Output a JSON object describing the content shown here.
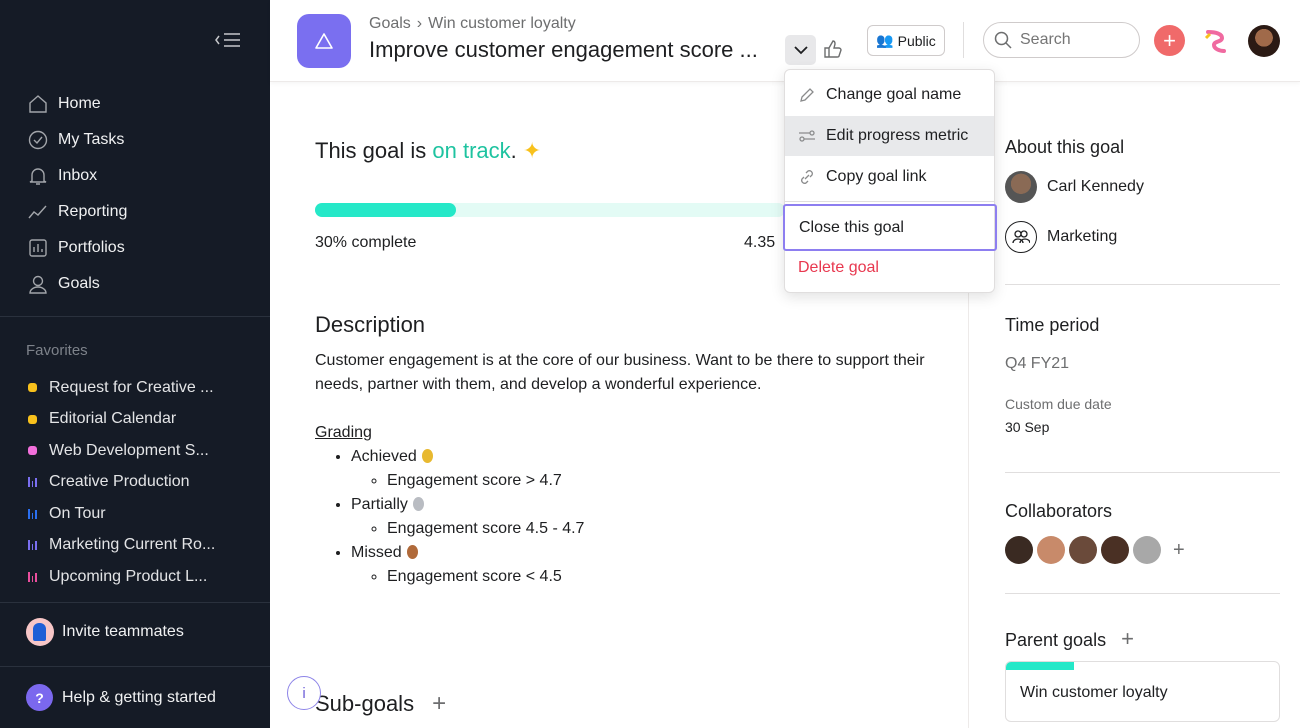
{
  "sidebar": {
    "collapse_icon": "collapse-sidebar-icon",
    "nav": [
      {
        "label": "Home",
        "icon": "home-icon"
      },
      {
        "label": "My Tasks",
        "icon": "check-circle-icon"
      },
      {
        "label": "Inbox",
        "icon": "bell-icon"
      },
      {
        "label": "Reporting",
        "icon": "line-chart-icon"
      },
      {
        "label": "Portfolios",
        "icon": "portfolio-icon"
      },
      {
        "label": "Goals",
        "icon": "person-icon"
      }
    ],
    "favorites_title": "Favorites",
    "favorites": [
      {
        "label": "Request for Creative ...",
        "type": "dot",
        "color": "#f8c11c"
      },
      {
        "label": "Editorial Calendar",
        "type": "dot",
        "color": "#f8c11c"
      },
      {
        "label": "Web Development S...",
        "type": "dot",
        "color": "#f26fdb"
      },
      {
        "label": "Creative Production",
        "type": "bars",
        "color": "#7a6ff0"
      },
      {
        "label": "On Tour",
        "type": "bars",
        "color": "#2a6ff0"
      },
      {
        "label": "Marketing Current Ro...",
        "type": "bars",
        "color": "#7a6ff0"
      },
      {
        "label": "Upcoming Product L...",
        "type": "bars",
        "color": "#ea4e9d"
      }
    ],
    "invite": "Invite teammates",
    "help": "Help & getting started",
    "help_icon_glyph": "?"
  },
  "header": {
    "breadcrumb": [
      "Goals",
      "Win customer loyalty"
    ],
    "title": "Improve customer engagement score ...",
    "public_label": "Public",
    "search_placeholder": "Search",
    "add_glyph": "+"
  },
  "menu": {
    "items": [
      {
        "label": "Change goal name",
        "icon": "pencil-icon"
      },
      {
        "label": "Edit progress metric",
        "icon": "sliders-icon"
      },
      {
        "label": "Copy goal link",
        "icon": "link-icon"
      },
      {
        "label": "Close this goal"
      },
      {
        "label": "Delete goal"
      }
    ]
  },
  "main": {
    "status_prefix": "This goal is ",
    "status_value": "on track",
    "status_suffix": ".",
    "status_color": "#1ec3a0",
    "progress_percent": 30,
    "progress_label": "30% complete",
    "current_value": "4.35",
    "description_heading": "Description",
    "description": "Customer engagement is at the core of our business. Want to be there to support their needs, partner with them, and develop a wonderful experience.",
    "grading_title": "Grading",
    "grades": [
      {
        "label": "Achieved",
        "medal": "gold-medal-icon",
        "criterion": "Engagement score > 4.7"
      },
      {
        "label": "Partially",
        "medal": "silver-medal-icon",
        "criterion": "Engagement score 4.5 - 4.7"
      },
      {
        "label": "Missed",
        "medal": "bronze-medal-icon",
        "criterion": "Engagement score < 4.5"
      }
    ],
    "subgoals_heading": "Sub-goals",
    "add_glyph": "+",
    "info_glyph": "i"
  },
  "right": {
    "about_heading": "About this goal",
    "owner": "Carl Kennedy",
    "team": "Marketing",
    "time_heading": "Time period",
    "time_period": "Q4 FY21",
    "due_label": "Custom due date",
    "due_value": "30 Sep",
    "collaborators_heading": "Collaborators",
    "add_glyph": "+",
    "parent_heading": "Parent goals",
    "parent_goal": "Win customer loyalty"
  }
}
